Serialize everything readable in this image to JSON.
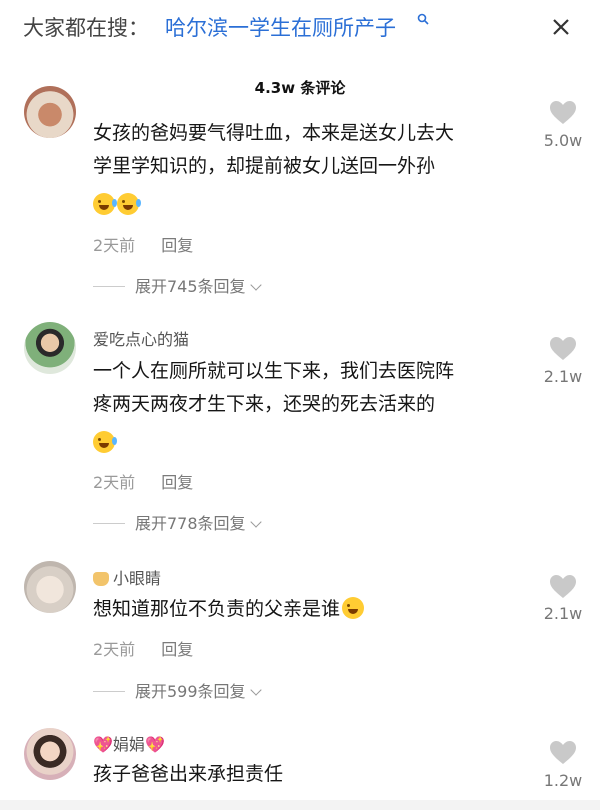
{
  "search": {
    "prefix": "大家都在搜：",
    "query": "哈尔滨一学生在厕所产子",
    "icon": "search-icon",
    "close_icon": "close-icon"
  },
  "comment_count": "4.3w 条评论",
  "comments": [
    {
      "user": "",
      "text_line1": "女孩的爸妈要气得吐血，本来是送女儿去大",
      "text_line2": "学里学知识的，却提前被女儿送回一外孙",
      "emoji": "laughing-crying-emoji",
      "time": "2天前",
      "reply": "回复",
      "expand": "展开745条回复",
      "likes": "5.0w"
    },
    {
      "user": "爱吃点心的猫",
      "text_line1": "一个人在厕所就可以生下来，我们去医院阵",
      "text_line2": "疼两天两夜才生下来，还哭的死去活来的",
      "emoji": "laughing-crying-emoji",
      "time": "2天前",
      "reply": "回复",
      "expand": "展开778条回复",
      "likes": "2.1w"
    },
    {
      "user": "小眼睛",
      "text_line1": "想知道那位不负责的父亲是谁",
      "emoji": "pleading-emoji",
      "time": "2天前",
      "reply": "回复",
      "expand": "展开599条回复",
      "likes": "2.1w"
    },
    {
      "user": "娟娟",
      "text_line1": "孩子爸爸出来承担责任",
      "likes": "1.2w"
    }
  ],
  "colors": {
    "accent": "#2b6fd6",
    "heart": "#c9c9c9",
    "meta": "#9a9a9a"
  }
}
